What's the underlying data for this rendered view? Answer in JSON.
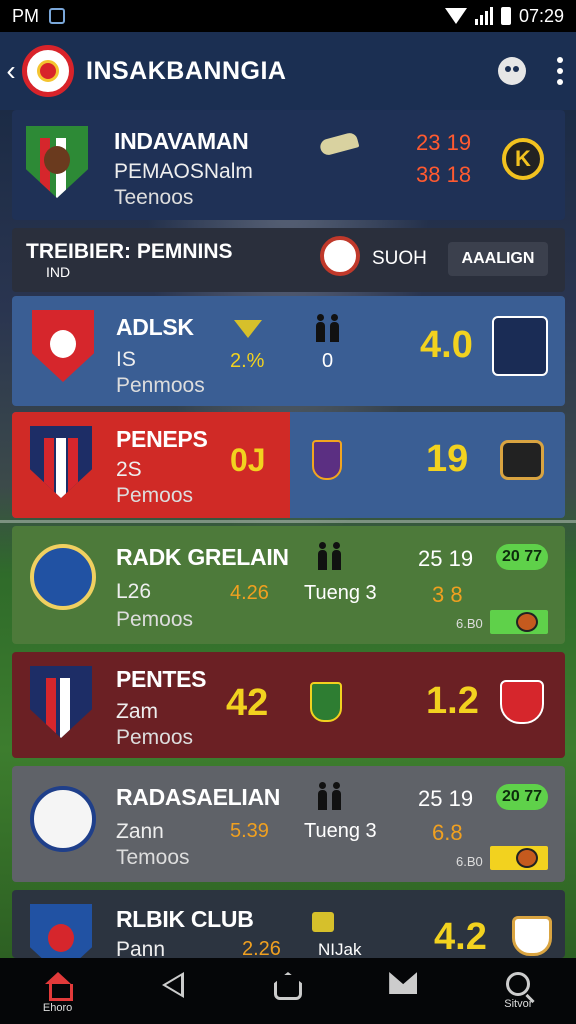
{
  "status_bar": {
    "left_text": "PM",
    "time": "07:29"
  },
  "header": {
    "title": "INSAKBANNGIA"
  },
  "top_match": {
    "team_name": "INDAVAMAN",
    "team_sub": "PEMAOSNalm",
    "team_meta": "Teenoos",
    "score_top": "23 19",
    "score_bottom": "38 18",
    "badge_letter": "K"
  },
  "filter_bar": {
    "title": "TREIBIER: PEMNINS",
    "subtitle": "IND",
    "search_label": "SUOH",
    "button_label": "AAALIGN"
  },
  "matches": [
    {
      "name": "ADLSK",
      "sub": "IS",
      "meta": "Penmoos",
      "stat": "2.%",
      "count": "0",
      "score": "4.0"
    },
    {
      "name": "PENEPS",
      "sub": "2S",
      "meta": "Pemoos",
      "stat": "0J",
      "score": "19"
    },
    {
      "name": "RADK GRELAIN",
      "sub": "L26",
      "meta": "Pemoos",
      "stat": "4.26",
      "team_label": "Tueng 3",
      "score_top": "25 19",
      "score_bottom": "3 8",
      "pill": "20 77",
      "bar_label": "6.B0"
    },
    {
      "name": "PENTES",
      "sub": "Zam",
      "meta": "Pemoos",
      "stat": "42",
      "score": "1.2"
    },
    {
      "name": "RADASAELIAN",
      "sub": "Zann",
      "meta": "Temoos",
      "stat": "5.39",
      "team_label": "Tueng 3",
      "score_top": "25 19",
      "score_bottom": "6.8",
      "pill": "20 77",
      "bar_label": "6.B0"
    },
    {
      "name": "RLBIK CLUB",
      "sub": "Pann",
      "stat": "2.26",
      "team_label": "NIJak",
      "score": "4.2"
    }
  ],
  "bottom_nav": [
    {
      "label": "Ehoro",
      "icon": "home-icon"
    },
    {
      "label": "",
      "icon": "back-icon"
    },
    {
      "label": "",
      "icon": "home-button-icon"
    },
    {
      "label": "",
      "icon": "mail-icon"
    },
    {
      "label": "Sitvor",
      "icon": "search-icon"
    }
  ],
  "colors": {
    "header_bg": "#1b2f52",
    "card_dark": "#1f3156",
    "card_blue": "#3a5e94",
    "card_red": "#d02a26",
    "card_green": "#4d7a3a",
    "card_maroon": "#6b2024",
    "card_gray": "#5f6268",
    "accent_yellow": "#f2d21f"
  }
}
